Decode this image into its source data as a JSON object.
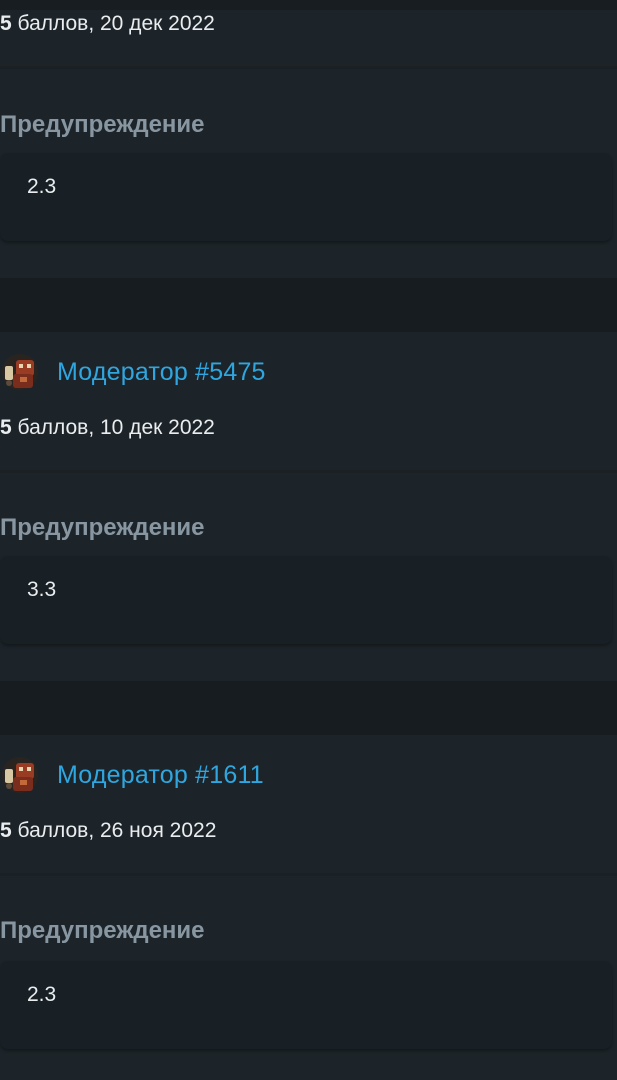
{
  "entries": [
    {
      "moderator": "",
      "points_bold": "5",
      "points_rest": " баллов, 20 дек 2022",
      "section_title": "Предупреждение",
      "value": "2.3"
    },
    {
      "moderator": "Модератор #5475",
      "points_bold": "5",
      "points_rest": " баллов, 10 дек 2022",
      "section_title": "Предупреждение",
      "value": "3.3"
    },
    {
      "moderator": "Модератор #1611",
      "points_bold": "5",
      "points_rest": " баллов, 26 ноя 2022",
      "section_title": "Предупреждение",
      "value": "2.3"
    }
  ],
  "icons": {
    "avatar": "robot-avatar-icon"
  },
  "colors": {
    "background": "#1b2227",
    "link": "#2fa6df",
    "section_title": "#8796a1",
    "text": "#e9edf0",
    "value_box": "#182025"
  }
}
